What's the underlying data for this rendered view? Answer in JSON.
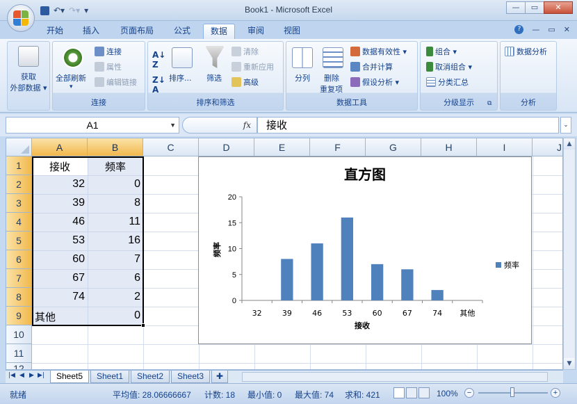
{
  "window": {
    "title": "Book1 - Microsoft Excel",
    "minimize": "—",
    "restore": "▭",
    "close": "✕"
  },
  "qat": {
    "save_icon": "save-icon",
    "undo": "↶▾",
    "redo": "↷▾",
    "customize": "▾"
  },
  "tabs": [
    "开始",
    "插入",
    "页面布局",
    "公式",
    "数据",
    "审阅",
    "视图"
  ],
  "active_tab": "数据",
  "ribbon": {
    "groups": {
      "external": {
        "big_button_line1": "获取",
        "big_button_line2": "外部数据 ▾"
      },
      "connections": {
        "label": "连接",
        "refresh_all": "全部刷新",
        "refresh_drop": "▾",
        "connections": "连接",
        "properties": "属性",
        "edit_links": "编辑链接"
      },
      "sort_filter": {
        "label": "排序和筛选",
        "sort": "排序...",
        "filter": "筛选",
        "clear": "清除",
        "reapply": "重新应用",
        "advanced": "高级"
      },
      "data_tools": {
        "label": "数据工具",
        "text_to_columns": "分列",
        "remove_duplicates_1": "删除",
        "remove_duplicates_2": "重复项",
        "data_validation": "数据有效性 ▾",
        "consolidate": "合并计算",
        "what_if": "假设分析 ▾"
      },
      "outline": {
        "label": "分级显示",
        "group": "组合 ▾",
        "ungroup": "取消组合 ▾",
        "subtotal": "分类汇总"
      },
      "analysis": {
        "label": "分析",
        "data_analysis": "数据分析"
      }
    }
  },
  "formula_bar": {
    "name_box": "A1",
    "fx": "fx",
    "content": "接收"
  },
  "columns": [
    "A",
    "B",
    "C",
    "D",
    "E",
    "F",
    "G",
    "H",
    "I",
    "J"
  ],
  "rows": [
    "1",
    "2",
    "3",
    "4",
    "5",
    "6",
    "7",
    "8",
    "9",
    "10",
    "11",
    "12"
  ],
  "cells": {
    "header_a": "接收",
    "header_b": "频率",
    "rows": [
      {
        "a": "32",
        "b": "0"
      },
      {
        "a": "39",
        "b": "8"
      },
      {
        "a": "46",
        "b": "11"
      },
      {
        "a": "53",
        "b": "16"
      },
      {
        "a": "60",
        "b": "7"
      },
      {
        "a": "67",
        "b": "6"
      },
      {
        "a": "74",
        "b": "2"
      },
      {
        "a": "其他",
        "b": "0"
      }
    ]
  },
  "chart_data": {
    "type": "bar",
    "title": "直方图",
    "xlabel": "接收",
    "ylabel": "频率",
    "categories": [
      "32",
      "39",
      "46",
      "53",
      "60",
      "67",
      "74",
      "其他"
    ],
    "series": [
      {
        "name": "频率",
        "values": [
          0,
          8,
          11,
          16,
          7,
          6,
          2,
          0
        ],
        "color": "#4f81bd"
      }
    ],
    "ylim": [
      0,
      20
    ],
    "yticks": [
      "0",
      "5",
      "10",
      "15",
      "20"
    ],
    "legend_position": "right",
    "grid": false
  },
  "sheets": [
    "Sheet5",
    "Sheet1",
    "Sheet2",
    "Sheet3"
  ],
  "active_sheet": "Sheet5",
  "status": {
    "mode": "就绪",
    "average": "平均值: 28.06666667",
    "count": "计数: 18",
    "min": "最小值: 0",
    "max": "最大值: 74",
    "sum": "求和: 421",
    "zoom": "100%"
  },
  "colors": {
    "accent": "#15428b",
    "selection_header": "#f2b84d",
    "bar": "#4f81bd"
  }
}
